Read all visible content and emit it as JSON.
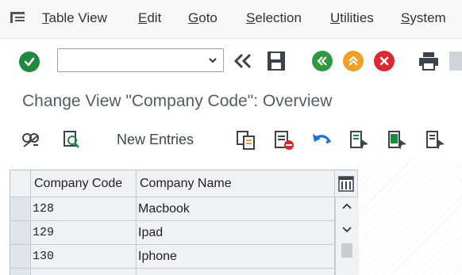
{
  "menu": {
    "items": [
      {
        "pre": "",
        "ul": "T",
        "post": "able View"
      },
      {
        "pre": "",
        "ul": "E",
        "post": "dit"
      },
      {
        "pre": "",
        "ul": "G",
        "post": "oto"
      },
      {
        "pre": "",
        "ul": "S",
        "post": "election"
      },
      {
        "pre": "",
        "ul": "U",
        "post": "tilities"
      },
      {
        "pre": "",
        "ul": "S",
        "post": "ystem"
      }
    ]
  },
  "toolbar": {
    "command_value": "",
    "colors": {
      "enter": "#1e8a3c",
      "back": "#2e9a3e",
      "exit": "#f0a020",
      "cancel": "#e0262f"
    }
  },
  "title": "Change View \"Company Code\": Overview",
  "app_toolbar": {
    "new_entries_label": "New Entries"
  },
  "table": {
    "columns": [
      "Company Code",
      "Company Name"
    ],
    "rows": [
      {
        "code": "128",
        "name": "Macbook"
      },
      {
        "code": "129",
        "name": "Ipad"
      },
      {
        "code": "130",
        "name": "Iphone"
      }
    ]
  }
}
